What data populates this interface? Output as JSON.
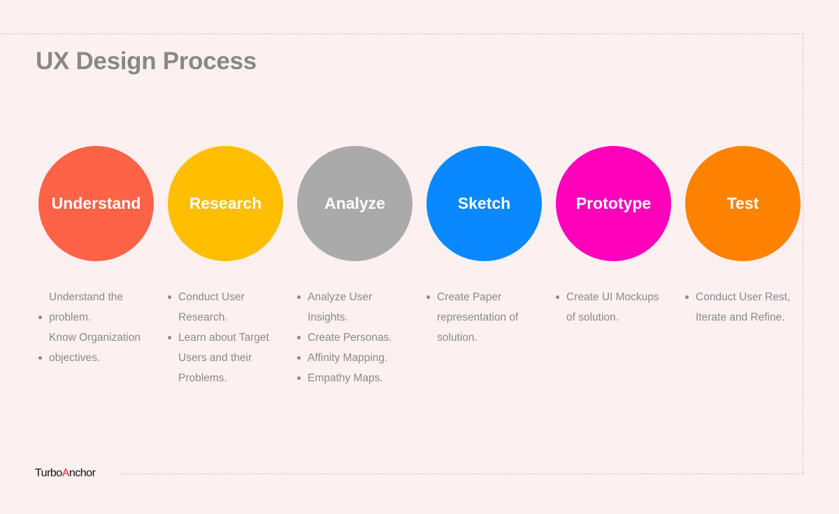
{
  "title": "UX Design Process",
  "stages": [
    {
      "label": "Understand",
      "color": "#ff6347",
      "bullets": [
        {
          "text": "Understand the",
          "dot": false
        },
        {
          "text": "problem.",
          "dot": true
        },
        {
          "text": "Know Organization",
          "dot": false
        },
        {
          "text": "objectives.",
          "dot": true
        }
      ]
    },
    {
      "label": "Research",
      "color": "#ffbf00",
      "bullets": [
        {
          "text": "Conduct User",
          "dot": true
        },
        {
          "text": "Research.",
          "dot": false
        },
        {
          "text": "Learn about Target",
          "dot": true
        },
        {
          "text": "Users and their",
          "dot": false
        },
        {
          "text": "Problems.",
          "dot": false
        }
      ]
    },
    {
      "label": "Analyze",
      "color": "#aaaaaa",
      "bullets": [
        {
          "text": "Analyze User",
          "dot": true
        },
        {
          "text": "Insights.",
          "dot": false
        },
        {
          "text": "Create Personas.",
          "dot": true
        },
        {
          "text": "Affinity Mapping.",
          "dot": true
        },
        {
          "text": "Empathy Maps.",
          "dot": true
        }
      ]
    },
    {
      "label": "Sketch",
      "color": "#0a88ff",
      "bullets": [
        {
          "text": "Create Paper",
          "dot": true
        },
        {
          "text": "representation of",
          "dot": false
        },
        {
          "text": "solution.",
          "dot": false
        }
      ]
    },
    {
      "label": "Prototype",
      "color": "#ff00bb",
      "bullets": [
        {
          "text": "Create UI Mockups",
          "dot": true
        },
        {
          "text": "of solution.",
          "dot": false
        }
      ]
    },
    {
      "label": "Test",
      "color": "#ff8200",
      "bullets": [
        {
          "text": "Conduct User Rest,",
          "dot": true
        },
        {
          "text": "Iterate and Refine.",
          "dot": false
        }
      ]
    }
  ],
  "logo": {
    "part1": "Turbo",
    "accent": "A",
    "part2": "nchor"
  }
}
